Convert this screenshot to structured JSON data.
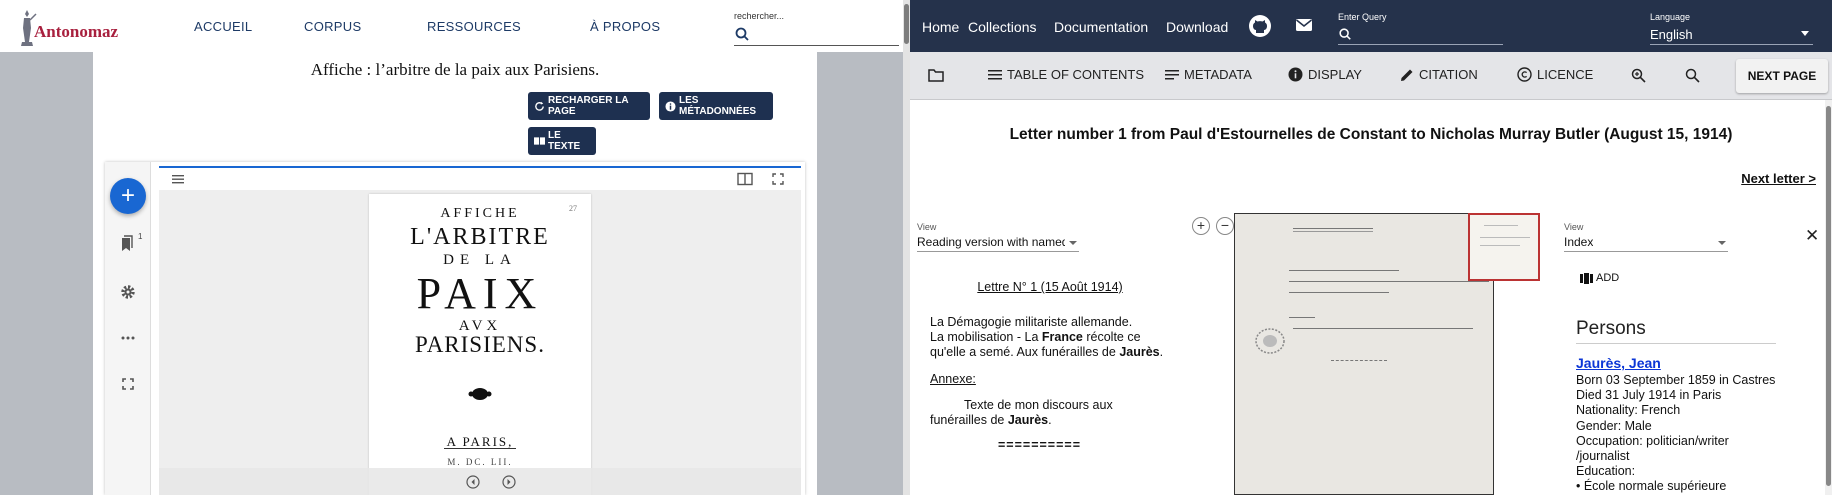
{
  "left": {
    "logo_text": "Antonomaz",
    "nav": [
      "ACCUEIL",
      "CORPUS",
      "RESSOURCES",
      "À PROPOS"
    ],
    "search_placeholder": "rechercher...",
    "title": "Affiche : l’arbitre de la paix aux Parisiens.",
    "buttons": {
      "reload": "RECHARGER LA PAGE",
      "metadata": "LES MÉTADONNÉES",
      "text": "LE TEXTE"
    },
    "bookmark_badge": "1",
    "page_lines": [
      "AFFICHE",
      "L'ARBITRE",
      "DE LA",
      "PAIX",
      "AVX",
      "PARISIENS.",
      "A PARIS,"
    ],
    "page_number": "27",
    "page_footer": "M. DC. LII."
  },
  "right": {
    "nav": [
      "Home",
      "Collections",
      "Documentation",
      "Download"
    ],
    "query_label": "Enter Query",
    "language_label": "Language",
    "language_value": "English",
    "toolbar": {
      "toc": "TABLE OF CONTENTS",
      "metadata": "METADATA",
      "display": "DISPLAY",
      "citation": "CITATION",
      "licence": "LICENCE",
      "next_page": "NEXT PAGE"
    },
    "title": "Letter number 1 from Paul d'Estournelles de Constant to Nicholas Murray Butler (August 15, 1914)",
    "next_letter": "Next letter >",
    "view_left": {
      "label": "View",
      "value": "Reading version with named entities"
    },
    "view_right": {
      "label": "View",
      "value": "Index"
    },
    "text": {
      "heading": "Lettre N° 1 (15 Août 1914)",
      "p1_a": "La Démagogie militariste allemande.",
      "p1_b": "La mobilisation - La ",
      "p1_france": "France",
      "p1_c": " récolte ce qu'elle a semé. Aux funérailles de ",
      "p1_jaures": "Jaurès",
      "p1_d": ".",
      "annexe": "Annexe:",
      "p2_a": "Texte de mon discours aux funérailles de ",
      "p2_jaures": "Jaurès",
      "p2_b": ".",
      "separator": "=========="
    },
    "index": {
      "add": "ADD",
      "persons_heading": "Persons",
      "person_name": "Jaurès, Jean",
      "person_lines": [
        "Born 03 September 1859 in Castres",
        "Died 31 July 1914 in Paris",
        "Nationality: French",
        "Gender: Male",
        "Occupation: politician/writer",
        "/journalist",
        "Education:",
        "• École normale supérieure"
      ]
    }
  },
  "colors": {
    "antonomaz_red": "#a8203e",
    "antonomaz_navy": "#1e3050",
    "mirador_blue": "#1967d2",
    "evt_header": "#25324b",
    "link_blue": "#0b36d6"
  }
}
